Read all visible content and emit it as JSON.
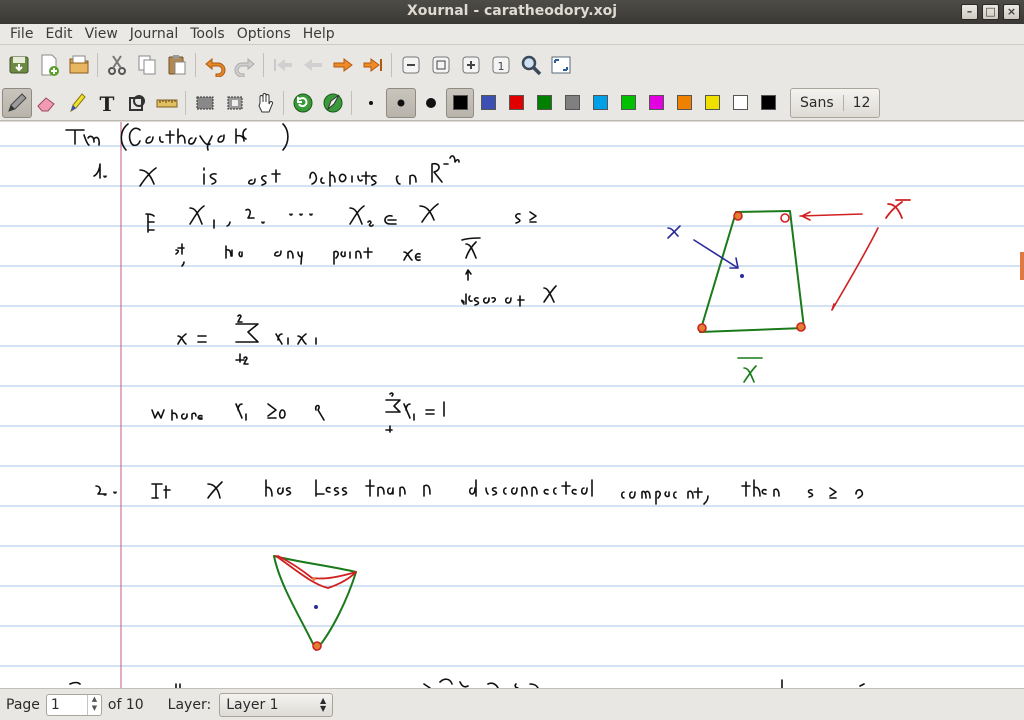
{
  "window": {
    "title": "Xournal - caratheodory.xoj"
  },
  "menu": {
    "items": [
      "File",
      "Edit",
      "View",
      "Journal",
      "Tools",
      "Options",
      "Help"
    ]
  },
  "toolbar_main": {
    "icons": [
      "save-icon",
      "new-page-icon",
      "open-folder-icon",
      "cut-icon",
      "copy-icon",
      "paste-icon",
      "undo-icon",
      "redo-icon",
      "first-page-icon",
      "previous-page-icon",
      "next-page-icon",
      "last-page-icon",
      "zoom-out-icon",
      "zoom-fit-icon",
      "zoom-in-icon",
      "zoom-100-icon",
      "find-icon",
      "fullscreen-icon"
    ]
  },
  "toolbar_tools": {
    "icons": [
      "pen-icon",
      "eraser-icon",
      "highlighter-icon",
      "text-icon",
      "shape-recognizer-icon",
      "ruler-icon",
      "select-rectangle-icon",
      "select-region-icon",
      "hand-icon",
      "refresh-icon",
      "default-tools-icon",
      "thin-dot-icon",
      "medium-dot-icon",
      "thick-dot-icon"
    ],
    "colors": [
      "#000000",
      "#3c50b4",
      "#e00000",
      "#008000",
      "#808080",
      "#00a0e8",
      "#00c000",
      "#e000e0",
      "#f08000",
      "#f0e000",
      "#ffffff"
    ],
    "active_color": "#000000",
    "font_name": "Sans",
    "font_size": "12"
  },
  "status": {
    "page_label": "Page",
    "page_value": "1",
    "page_total": "of 10",
    "layer_label": "Layer:",
    "layer_value": "Layer 1"
  }
}
